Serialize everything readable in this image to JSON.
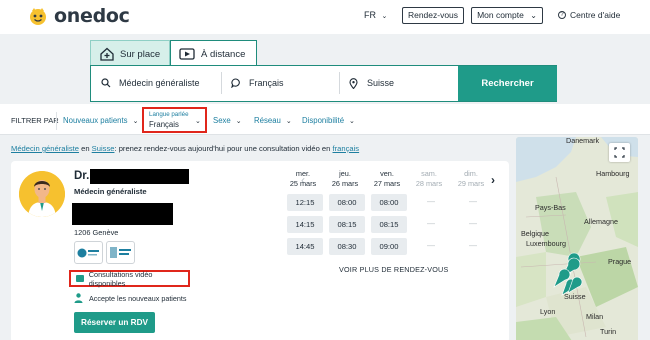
{
  "header": {
    "logo_text": "onedoc",
    "language": "FR",
    "rdv_button": "Rendez-vous",
    "account_button": "Mon compte",
    "help": "Centre d'aide"
  },
  "search": {
    "tabs": [
      {
        "label": "Sur place"
      },
      {
        "label": "À distance"
      }
    ],
    "specialty": "Médecin généraliste",
    "language": "Français",
    "location": "Suisse",
    "button": "Rechercher"
  },
  "filters": {
    "label": "FILTRER PAR",
    "items": [
      {
        "label": "Nouveaux patients"
      },
      {
        "label": "Sexe"
      },
      {
        "label": "Réseau"
      },
      {
        "label": "Disponibilité"
      }
    ],
    "language_filter": {
      "caption": "Langue parlée",
      "value": "Français"
    }
  },
  "intro": {
    "specialty_link": "Médecin généraliste",
    "connector": "en",
    "country_link": "Suisse",
    "text": ": prenez rendez-vous aujourd'hui pour une consultation vidéo en",
    "language_link": "français"
  },
  "doctor": {
    "title": "Dr.",
    "specialty": "Médecin généraliste",
    "address": "1206 Genève",
    "video": "Consultations vidéo disponibles",
    "new_patients": "Accepte les nouveaux patients",
    "book_button": "Réserver un RDV"
  },
  "calendar": {
    "days": [
      {
        "name": "mer.",
        "date": "25 mars",
        "available": true
      },
      {
        "name": "jeu.",
        "date": "26 mars",
        "available": true
      },
      {
        "name": "ven.",
        "date": "27 mars",
        "available": true
      },
      {
        "name": "sam.",
        "date": "28 mars",
        "available": false
      },
      {
        "name": "dim.",
        "date": "29 mars",
        "available": false
      }
    ],
    "slots": [
      [
        "12:15",
        "08:00",
        "08:00",
        "—",
        "—"
      ],
      [
        "14:15",
        "08:15",
        "08:15",
        "—",
        "—"
      ],
      [
        "14:45",
        "08:30",
        "09:00",
        "—",
        "—"
      ]
    ],
    "see_more": "VOIR PLUS DE RENDEZ-VOUS"
  },
  "map": {
    "labels": [
      "Danemark",
      "Hambourg",
      "Pays-Bas",
      "Allemagne",
      "Belgique",
      "Luxembourg",
      "Suisse",
      "Lyon",
      "Milan",
      "Turin",
      "Prague"
    ]
  },
  "colors": {
    "accent": "#1f9b89",
    "link": "#1d7fa0",
    "highlight": "#e0261b"
  }
}
